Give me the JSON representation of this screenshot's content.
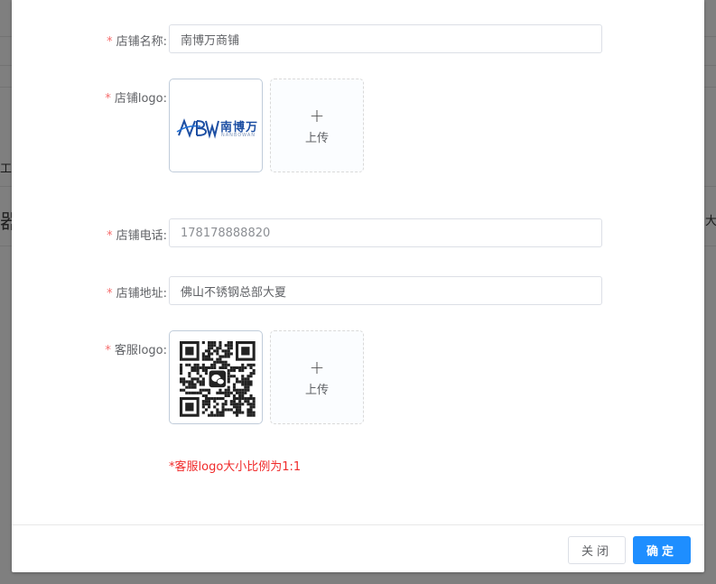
{
  "background": {
    "fragment_left": "工统",
    "fragment_icon": "器",
    "fragment_right": "大"
  },
  "form": {
    "shop_name_label": "店铺名称:",
    "shop_name_value": "南博万商铺",
    "shop_logo_label": "店铺logo:",
    "shop_logo_main_text": "南博万",
    "shop_logo_sub_text": "NANBOWAN",
    "shop_logo_letters": "NBW",
    "upload_plus": "+",
    "upload_text": "上传",
    "phone_label": "店铺电话:",
    "phone_value": "178178888820",
    "address_label": "店铺地址:",
    "address_value": "佛山不锈钢总部大夏",
    "service_logo_label": "客服logo:",
    "hint": "*客服logo大小比例为1:1",
    "required_mark": "*"
  },
  "footer": {
    "close_label": "关闭",
    "ok_label": "确定"
  },
  "colors": {
    "primary": "#1e8eff",
    "required": "#f56c6c",
    "hint": "#f02b2b",
    "logo_blue": "#1d4fa3"
  }
}
